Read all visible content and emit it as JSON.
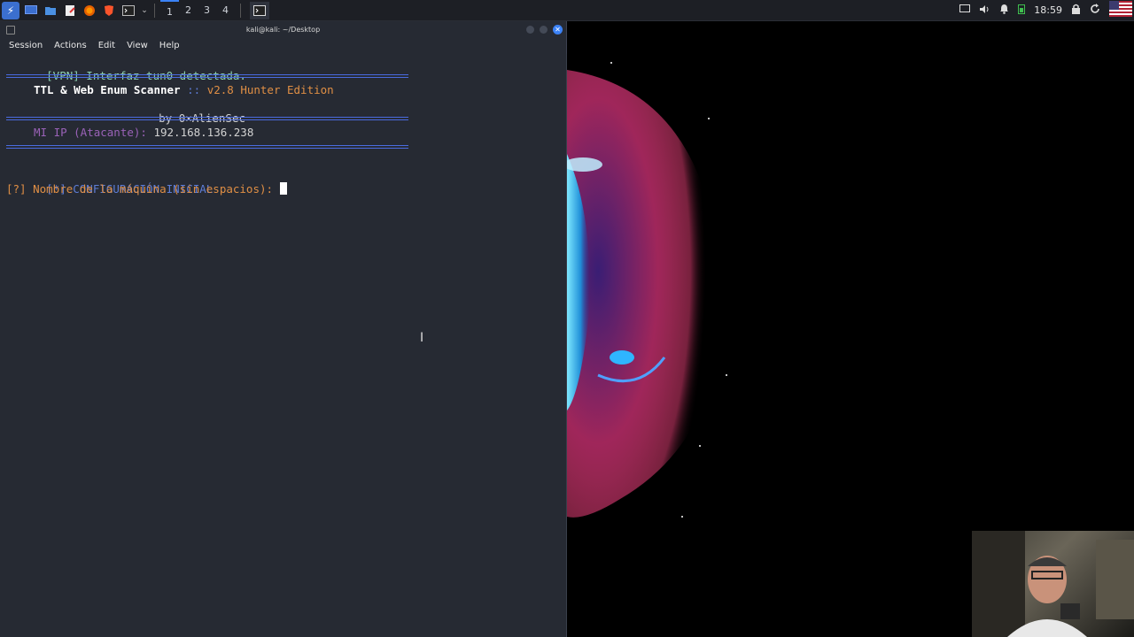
{
  "panel": {
    "workspaces": [
      "1",
      "2",
      "3",
      "4"
    ],
    "active_workspace": "1",
    "clock": "18:59",
    "icons": [
      "kali-menu-icon",
      "desktop-icon",
      "file-manager-icon",
      "text-editor-icon",
      "firefox-icon",
      "brave-icon",
      "terminal-icon",
      "terminal-task-icon",
      "display-icon",
      "volume-icon",
      "bell-icon",
      "battery-icon",
      "lock-icon",
      "refresh-icon",
      "us-flag-icon"
    ]
  },
  "terminal": {
    "title": "kali@kali: ~/Desktop",
    "menu": [
      "Session",
      "Actions",
      "Edit",
      "View",
      "Help"
    ],
    "vpn_line": "[VPN] Interfaz tun0 detectada.",
    "banner_name": "TTL & Web Enum Scanner",
    "banner_sep": " :: ",
    "banner_version": "v2.8 Hunter Edition",
    "banner_by": "by 0×AlienSec",
    "ip_label": "MI IP (Atacante):",
    "ip_value": "192.168.136.238",
    "config_line": "[*] CONFIGURACIÓN INICIAL",
    "prompt_line": "[?] Nombre de la máquina (sin espacios): "
  },
  "colors": {
    "terminal_bg": "#262a33",
    "accent_blue": "#4a6be0",
    "orange": "#e08f45",
    "teal": "#8fd0b0",
    "purple": "#9a62b8"
  }
}
